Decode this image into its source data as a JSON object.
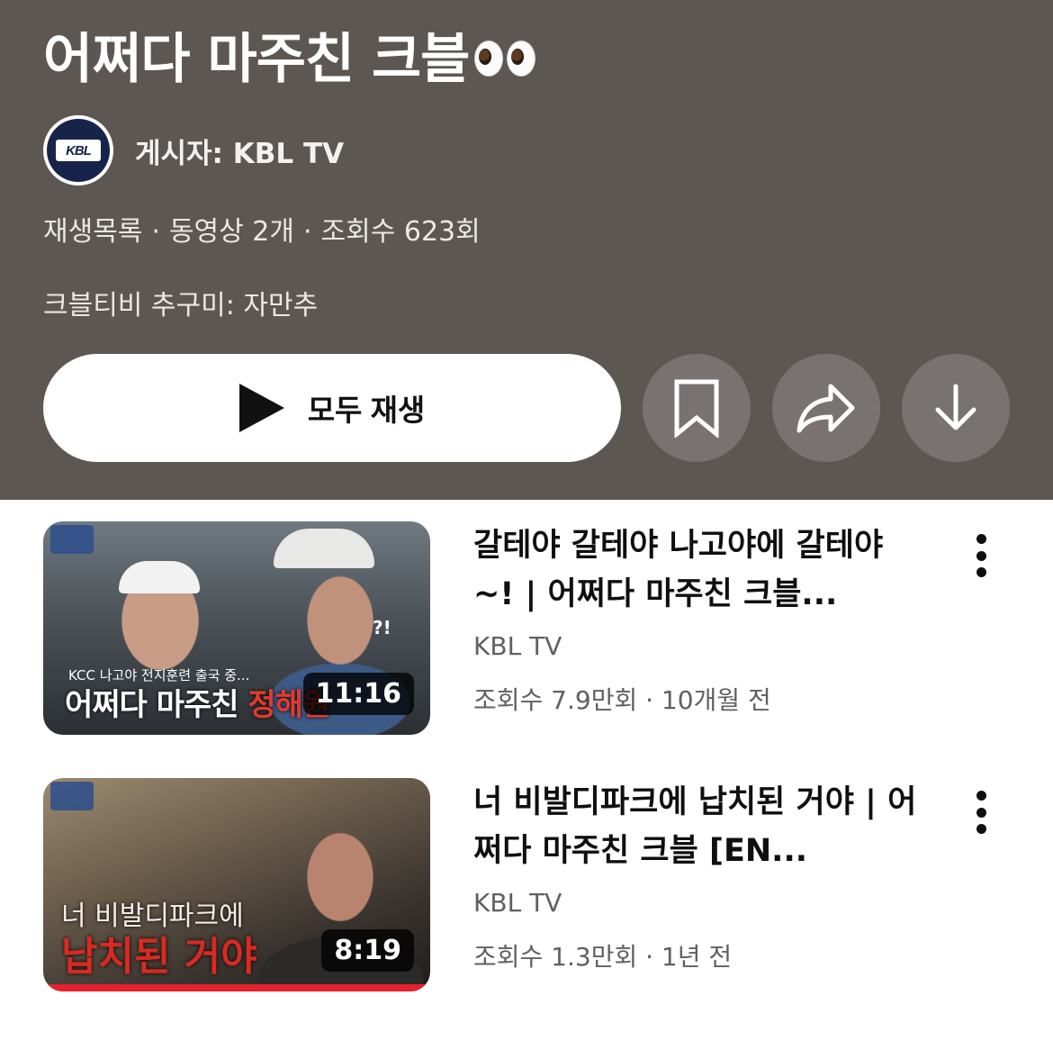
{
  "playlist": {
    "title": "어쩌다 마주친 크블",
    "title_emoji": "eyes-emoji",
    "author_line": "게시자: KBL TV",
    "avatar_text": "KBL",
    "type": "재생목록",
    "video_count": "동영상 2개",
    "views": "조회수 623회",
    "separator": "·",
    "description": "크블티비 추구미: 자만추",
    "play_all_label": "모두 재생",
    "actions": [
      {
        "icon": "bookmark-icon"
      },
      {
        "icon": "share-icon"
      },
      {
        "icon": "download-icon"
      }
    ]
  },
  "videos": [
    {
      "title": "갈테야 갈테야 나고야에 갈테야~! | 어쩌다 마주친 크블...",
      "channel": "KBL TV",
      "meta": "조회수 7.9만회 · 10개월 전",
      "duration": "11:16",
      "thumb_small_text": "KCC 나고야 전지훈련 출국 중...",
      "thumb_big_text": "어쩌다 마주친 ",
      "thumb_big_red": "정해원",
      "thumb_mark": "?!"
    },
    {
      "title": "너 비발디파크에 납치된 거야 | 어쩌다 마주친 크블 [EN...",
      "channel": "KBL TV",
      "meta": "조회수 1.3만회 · 1년 전",
      "duration": "8:19",
      "thumb_line1": "너 비발디파크에",
      "thumb_line2": "납치된 거야",
      "watched": 1.0
    }
  ],
  "colors": {
    "header_bg": "#5c5752",
    "circle_button_bg": "#787370",
    "progress_red": "#e4222e"
  }
}
